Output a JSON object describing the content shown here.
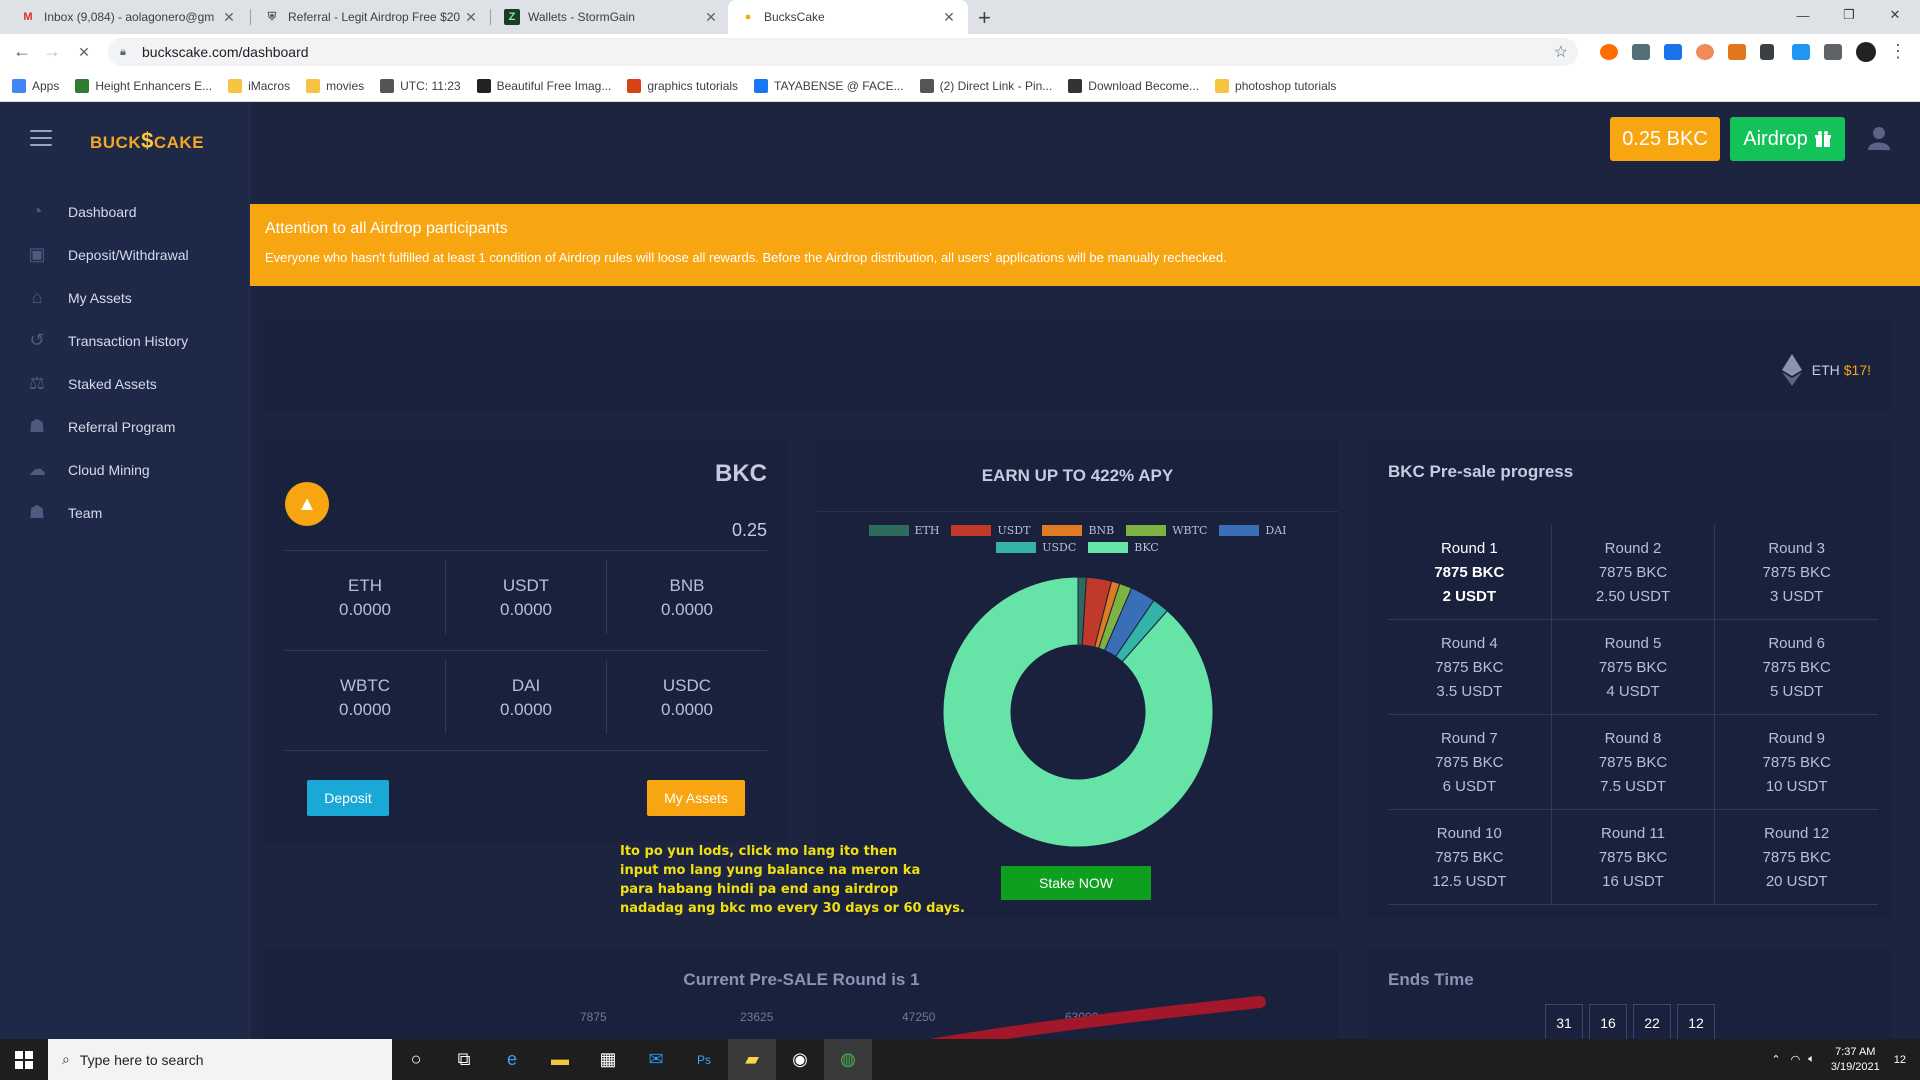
{
  "browser": {
    "tabs": [
      {
        "title": "Inbox (9,084) - aolagonero@gm",
        "icon": "gmail-icon"
      },
      {
        "title": "Referral - Legit Airdrop Free $20",
        "icon": "shield-icon"
      },
      {
        "title": "Wallets - StormGain",
        "icon": "stormgain-icon"
      },
      {
        "title": "BucksCake",
        "icon": "buckscake-icon"
      }
    ],
    "url": "buckscake.com/dashboard",
    "bookmarks": [
      {
        "label": "Apps",
        "color": "#4285f4"
      },
      {
        "label": "Height Enhancers E...",
        "color": "#2e7d32"
      },
      {
        "label": "iMacros",
        "color": "#f6c343"
      },
      {
        "label": "movies",
        "color": "#f6c343"
      },
      {
        "label": "UTC: 11:23",
        "color": "#555555"
      },
      {
        "label": "Beautiful Free Imag...",
        "color": "#222222"
      },
      {
        "label": "graphics tutorials",
        "color": "#d84315"
      },
      {
        "label": "TAYABENSE @ FACE...",
        "color": "#1877f2"
      },
      {
        "label": "(2) Direct Link - Pin...",
        "color": "#555555"
      },
      {
        "label": "Download Become...",
        "color": "#333333"
      },
      {
        "label": "photoshop tutorials",
        "color": "#f6c343"
      }
    ]
  },
  "sidebar": {
    "logo": {
      "left": "BUCK",
      "mid": "$",
      "right": "CAKE"
    },
    "items": [
      {
        "label": "Dashboard",
        "icon": "dashboard-icon"
      },
      {
        "label": "Deposit/Withdrawal",
        "icon": "wallet-icon"
      },
      {
        "label": "My Assets",
        "icon": "bank-icon"
      },
      {
        "label": "Transaction History",
        "icon": "history-icon"
      },
      {
        "label": "Staked Assets",
        "icon": "scale-icon"
      },
      {
        "label": "Referral Program",
        "icon": "users-icon"
      },
      {
        "label": "Cloud Mining",
        "icon": "cloud-icon"
      },
      {
        "label": "Team",
        "icon": "team-icon"
      }
    ]
  },
  "topbar": {
    "balance": "0.25 BKC",
    "airdrop": "Airdrop"
  },
  "alert": {
    "title": "Attention to all Airdrop participants",
    "body": "Everyone who hasn't fulfilled at least 1 condition of Airdrop rules will loose all rewards. Before the Airdrop distribution, all users' applications will be manually rechecked."
  },
  "ticker": {
    "symbol": "ETH",
    "price": "$17!"
  },
  "wallet": {
    "title": "BKC",
    "balance": "0.25",
    "assets": [
      {
        "symbol": "ETH",
        "value": "0.0000"
      },
      {
        "symbol": "USDT",
        "value": "0.0000"
      },
      {
        "symbol": "BNB",
        "value": "0.0000"
      },
      {
        "symbol": "WBTC",
        "value": "0.0000"
      },
      {
        "symbol": "DAI",
        "value": "0.0000"
      },
      {
        "symbol": "USDC",
        "value": "0.0000"
      }
    ],
    "deposit_label": "Deposit",
    "myassets_label": "My Assets"
  },
  "earn": {
    "title": "EARN UP TO 422% APY",
    "stake_label": "Stake NOW"
  },
  "chart_data": {
    "type": "pie",
    "title": "",
    "categories": [
      "ETH",
      "USDT",
      "BNB",
      "WBTC",
      "DAI",
      "USDC",
      "BKC"
    ],
    "values": [
      1,
      3,
      1,
      1.5,
      3,
      2,
      88.5
    ],
    "colors": [
      "#2f6b5c",
      "#c0392b",
      "#e07b23",
      "#7cb342",
      "#3a6fb8",
      "#34b3a8",
      "#66e3a6"
    ],
    "legend": "top"
  },
  "presale": {
    "title": "BKC Pre-sale progress",
    "rounds": [
      {
        "round": "Round 1",
        "amount": "7875 BKC",
        "price": "2 USDT",
        "active": true
      },
      {
        "round": "Round 2",
        "amount": "7875 BKC",
        "price": "2.50 USDT"
      },
      {
        "round": "Round 3",
        "amount": "7875 BKC",
        "price": "3 USDT"
      },
      {
        "round": "Round 4",
        "amount": "7875 BKC",
        "price": "3.5 USDT"
      },
      {
        "round": "Round 5",
        "amount": "7875 BKC",
        "price": "4 USDT"
      },
      {
        "round": "Round 6",
        "amount": "7875 BKC",
        "price": "5 USDT"
      },
      {
        "round": "Round 7",
        "amount": "7875 BKC",
        "price": "6 USDT"
      },
      {
        "round": "Round 8",
        "amount": "7875 BKC",
        "price": "7.5 USDT"
      },
      {
        "round": "Round 9",
        "amount": "7875 BKC",
        "price": "10 USDT"
      },
      {
        "round": "Round 10",
        "amount": "7875 BKC",
        "price": "12.5 USDT"
      },
      {
        "round": "Round 11",
        "amount": "7875 BKC",
        "price": "16 USDT"
      },
      {
        "round": "Round 12",
        "amount": "7875 BKC",
        "price": "20 USDT"
      }
    ]
  },
  "current": {
    "title": "Current Pre-SALE Round is 1",
    "ticks": [
      "7875",
      "23625",
      "47250",
      "63000"
    ]
  },
  "ends": {
    "title": "Ends Time",
    "values": [
      "31",
      "16",
      "22",
      "12"
    ]
  },
  "note": {
    "lines": [
      "Ito po yun lods, click mo lang ito then",
      "input mo lang yung balance na meron ka",
      "para habang hindi pa end ang airdrop",
      "nadadag ang bkc mo every 30 days or 60 days."
    ]
  },
  "taskbar": {
    "search_placeholder": "Type here to search",
    "time": "7:37 AM",
    "date": "3/19/2021",
    "notifications": "12"
  }
}
